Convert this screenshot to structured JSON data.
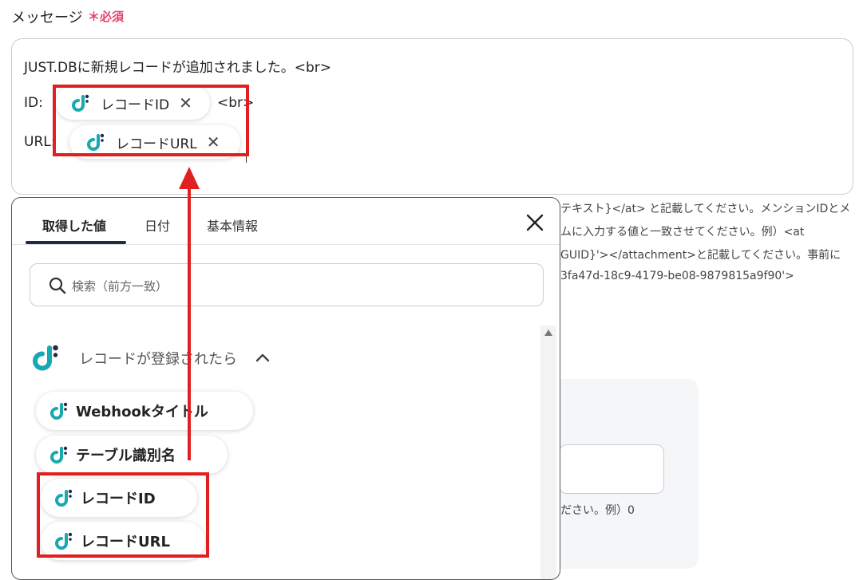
{
  "field": {
    "label": "メッセージ",
    "required_mark": "＊必須"
  },
  "message": {
    "line1": "JUST.DBに新規レコードが追加されました。<br>",
    "id_label": "ID:",
    "id_token": "レコードID",
    "br_text": "<br>",
    "url_label": "URL:",
    "url_token": "レコードURL",
    "close_glyph": "✕"
  },
  "background_help": [
    "テキスト}</at> と記載してください。メンションIDとメ",
    "ムに入力する値と一致させてください。例）<at",
    "GUID}'></attachment>と記載してください。事前に",
    "3fa47d-18c9-4179-be08-9879815a9f90'>"
  ],
  "background_hint": "ださい。例）0",
  "panel": {
    "tabs": [
      "取得した値",
      "日付",
      "基本情報"
    ],
    "active_tab": 0,
    "close_glyph": "✕",
    "search_placeholder": "検索（前方一致）",
    "group": {
      "title": "レコードが登録されたら",
      "chevron": "^"
    },
    "items": [
      "Webhookタイトル",
      "テーブル識別名",
      "レコードID",
      "レコードURL"
    ]
  },
  "colors": {
    "accent": "#e02020",
    "brand_teal": "#17a9b0",
    "brand_dark": "#1f2a44",
    "required": "#e8416f"
  },
  "icons": [
    "app-logo-icon",
    "search-icon",
    "close-icon",
    "chevron-up-icon",
    "scroll-up-icon",
    "scroll-down-icon"
  ]
}
